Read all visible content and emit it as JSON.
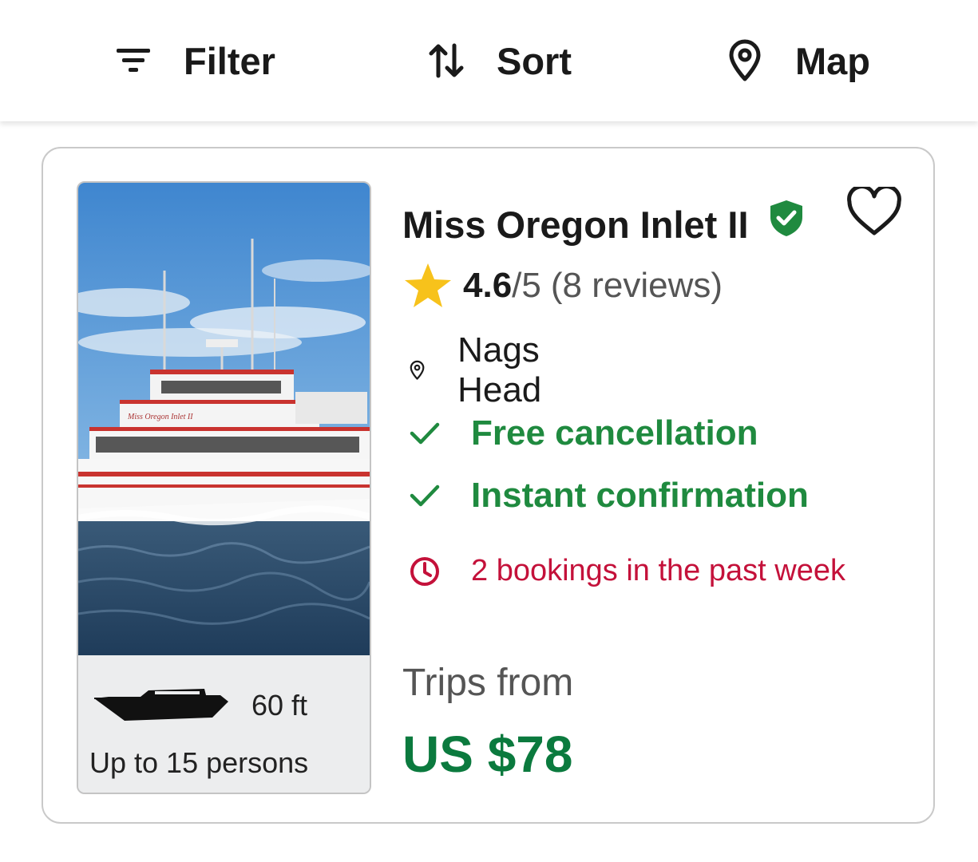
{
  "toolbar": {
    "filter_label": "Filter",
    "sort_label": "Sort",
    "map_label": "Map"
  },
  "listing": {
    "name": "Miss Oregon Inlet II",
    "verified": true,
    "rating": "4.6",
    "rating_scale": "/5",
    "reviews": "(8 reviews)",
    "location": "Nags Head",
    "features": [
      "Free cancellation",
      "Instant confirmation"
    ],
    "recent_bookings": "2 bookings in the past week",
    "boat_length": "60 ft",
    "capacity": "Up to 15 persons",
    "price_label": "Trips from",
    "price": "US $78",
    "photo_boat_name": "Miss Oregon Inlet II"
  },
  "colors": {
    "green_feature": "#1f8a3f",
    "price_green": "#0b7a3e",
    "verified_green": "#1f8a3f",
    "alert_red": "#c4113a",
    "star_yellow": "#f7c21b"
  },
  "icons": {
    "filter": "filter-icon",
    "sort": "sort-arrows-icon",
    "map": "map-pin-icon",
    "verified": "shield-check-icon",
    "favorite": "heart-outline-icon",
    "rating": "star-icon",
    "location": "map-pin-icon",
    "feature": "check-icon",
    "bookings": "clock-icon",
    "boat": "boat-silhouette-icon"
  }
}
